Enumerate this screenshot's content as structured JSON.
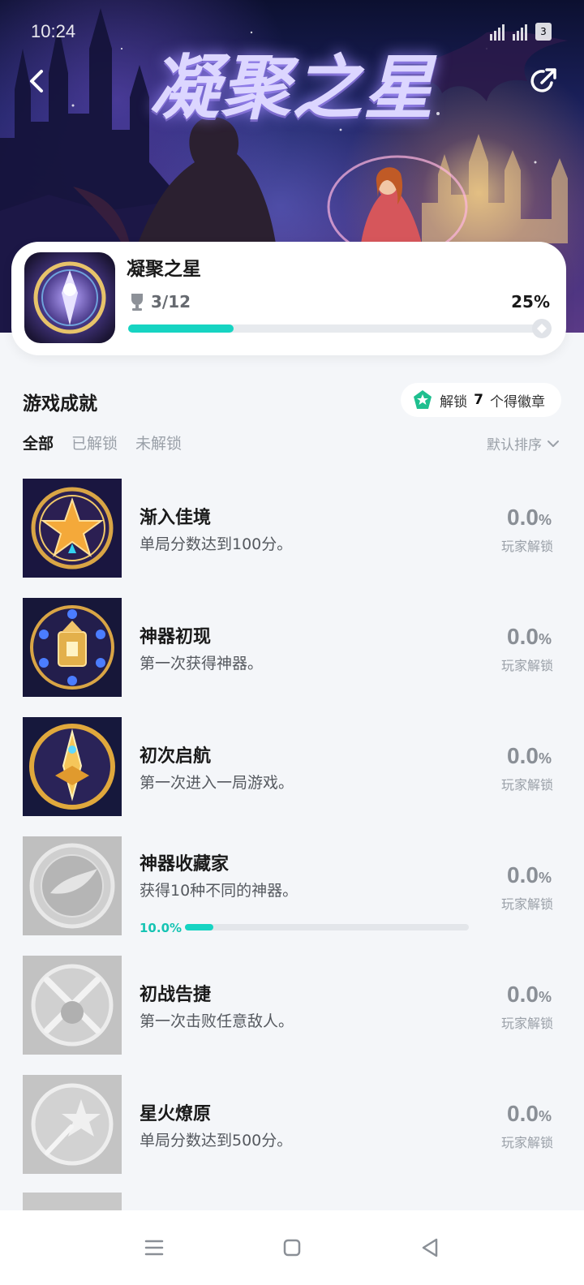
{
  "status_bar": {
    "time": "10:24",
    "battery": "3"
  },
  "hero": {
    "title": "凝聚之星"
  },
  "game": {
    "name": "凝聚之星",
    "progress_text": "3/12",
    "percent_text": "25%",
    "progress": 0.25
  },
  "section": {
    "title": "游戏成就",
    "chip_prefix": "解锁",
    "chip_count": "7",
    "chip_suffix": "个得徽章"
  },
  "tabs": [
    {
      "label": "全部",
      "active": true
    },
    {
      "label": "已解锁",
      "active": false
    },
    {
      "label": "未解锁",
      "active": false
    }
  ],
  "sort_label": "默认排序",
  "achievements": [
    {
      "name": "渐入佳境",
      "desc": "单局分数达到100分。",
      "pct": "0.0",
      "pct_unit": "%",
      "pct_label": "玩家解锁",
      "unlocked": true
    },
    {
      "name": "神器初现",
      "desc": "第一次获得神器。",
      "pct": "0.0",
      "pct_unit": "%",
      "pct_label": "玩家解锁",
      "unlocked": true
    },
    {
      "name": "初次启航",
      "desc": "第一次进入一局游戏。",
      "pct": "0.0",
      "pct_unit": "%",
      "pct_label": "玩家解锁",
      "unlocked": true
    },
    {
      "name": "神器收藏家",
      "desc": "获得10种不同的神器。",
      "pct": "0.0",
      "pct_unit": "%",
      "pct_label": "玩家解锁",
      "unlocked": false,
      "progress_text": "10.0%",
      "progress": 0.1
    },
    {
      "name": "初战告捷",
      "desc": "第一次击败任意敌人。",
      "pct": "0.0",
      "pct_unit": "%",
      "pct_label": "玩家解锁",
      "unlocked": false
    },
    {
      "name": "星火燎原",
      "desc": "单局分数达到500分。",
      "pct": "0.0",
      "pct_unit": "%",
      "pct_label": "玩家解锁",
      "unlocked": false
    }
  ],
  "colors": {
    "accent": "#16d4c2",
    "page_bg": "#f4f6f9",
    "card_bg": "#ffffff",
    "muted": "#9aa0a8"
  }
}
